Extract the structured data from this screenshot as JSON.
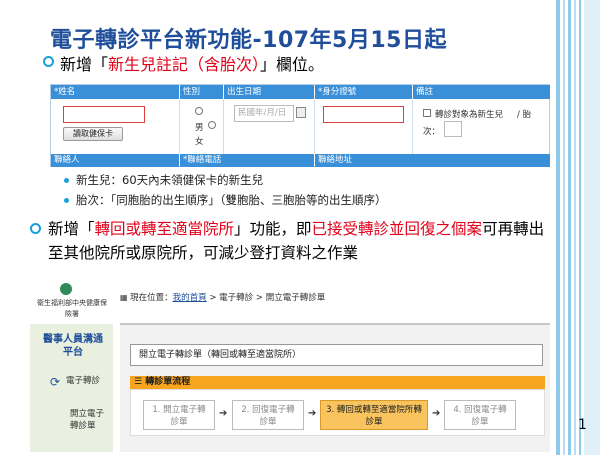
{
  "slide": {
    "title": "電子轉診平台新功能-107年5月15日起",
    "line1_prefix": "新增「",
    "line1_red": "新生兒註記（含胎次）",
    "line1_suffix": "」欄位。",
    "sub_bullets": [
      "新生兒：60天內未領健保卡的新生兒",
      "胎次：「同胞胎的出生順序」（雙胞胎、三胞胎等的出生順序）"
    ],
    "para_prefix": "新增「",
    "para_red1": "轉回或轉至適當院所",
    "para_mid": "」功能，即",
    "para_red2": "已接受轉診並回復之個案",
    "para_suffix": "可再轉出至其他院所或原院所，可減少登打資料之作業",
    "page_number": "1",
    "accent_color": "#1aa0d8",
    "title_color": "#1f4e9a",
    "highlight_color": "#e2001a"
  },
  "form": {
    "headers": [
      "*姓名",
      "性別",
      "出生日期",
      "*身分證號",
      "備註"
    ],
    "footers": [
      "聯絡人",
      "*聯絡電話",
      "聯絡地址"
    ],
    "read_card_button": "讀取健保卡",
    "gender_male": "男",
    "gender_female": "女",
    "date_placeholder": "民國年/月/日",
    "calendar_icon": "calendar-icon",
    "newborn_checkbox_label": "轉診對象為新生兒",
    "parity_label": "/ 胎",
    "parity_label2": "次："
  },
  "embedded": {
    "org_name": "衛生福利部中央健康保險署",
    "portal_title": "醫事人員溝通平台",
    "nav_section": "電子轉診",
    "nav_item": "開立電子轉診單",
    "breadcrumb_label": "現在位置：",
    "breadcrumb_home": "我的首頁",
    "breadcrumb_rest": " > 電子轉診 > 開立電子轉診單",
    "panel_title": "開立電子轉診單（轉回或轉至適當院所）",
    "flow_title": "轉診單流程",
    "steps": [
      "1. 開立電子轉診單",
      "2. 回復電子轉診單",
      "3. 轉回或轉至適當院所轉診單",
      "4. 回復電子轉診單"
    ]
  }
}
